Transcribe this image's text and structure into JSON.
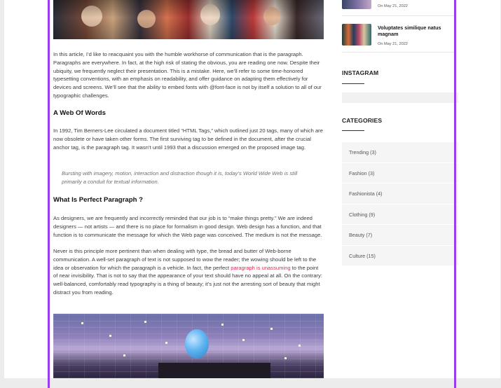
{
  "article": {
    "intro": "In this article, I’d like to reacquaint you with the humble workhorse of communication that is the paragraph. Paragraphs are everywhere. In fact, at the high risk of stating the obvious, you are reading one now. Despite their ubiquity, we frequently neglect their presentation. This is a mistake. Here, we’ll refer to some time-honored typesetting conventions, with an emphasis on readability, and offer guidance on adapting them effectively for devices and screens. We’ll see that the ability to embed fonts with @font-face is not by itself a solution to all of our typographic challenges.",
    "heading_web": "A Web Of Words",
    "web_text": "In 1992, Tim Berners-Lee circulated a document titled “HTML Tags,” which outlined just 20 tags, many of which are now obsolete or have taken other forms. The first surviving tag to be defined in the document, after the crucial anchor tag, is the paragraph tag. It wasn’t until 1993 that a discussion emerged on the proposed image tag.",
    "quote": "Bursting with imagery, motion, interaction and distraction though it is, today’s World Wide Web is still primarily a conduit for textual information.",
    "heading_paragraph": "What Is Perfect Paragraph ?",
    "designers_text": "As designers, we are frequently and incorrectly reminded that our job is to “make things pretty.” We are indeed designers — not artists — and there is no place for formalism in good design. Web design has a function, and that function is to communicate the message for which the Web page was conceived. The medium is not the message.",
    "never_before": "Never is this principle more pertinent than when dealing with type, the bread and butter of Web-borne communication. A well-set paragraph of text is not supposed to wow the reader; the wowing should be left to the idea or observation for which the paragraph is a vehicle. In fact, the perfect ",
    "never_link": "paragraph is unassuming",
    "never_after": " to the point of near invisibility. That is not to say that the appearance of your text should have no appeal at all. On the contrary: well-balanced, comfortably read typography is a thing of beauty; it’s just not the arresting sort of beauty that might distract you from reading."
  },
  "sidebar": {
    "posts": [
      {
        "title": "",
        "date": "On May 21, 2022"
      },
      {
        "title": "Voluptates similique natus magnam",
        "date": "On May 21, 2022"
      }
    ],
    "instagram_title": "INSTAGRAM",
    "categories_title": "CATEGORIES",
    "categories": [
      "Trending (3)",
      "Fashion (3)",
      "Fashionista (4)",
      "Clothing (9)",
      "Beauty (7)",
      "Culture (15)"
    ]
  },
  "colors": {
    "accent_line": "#9a3cf0",
    "link": "#e0284f"
  }
}
